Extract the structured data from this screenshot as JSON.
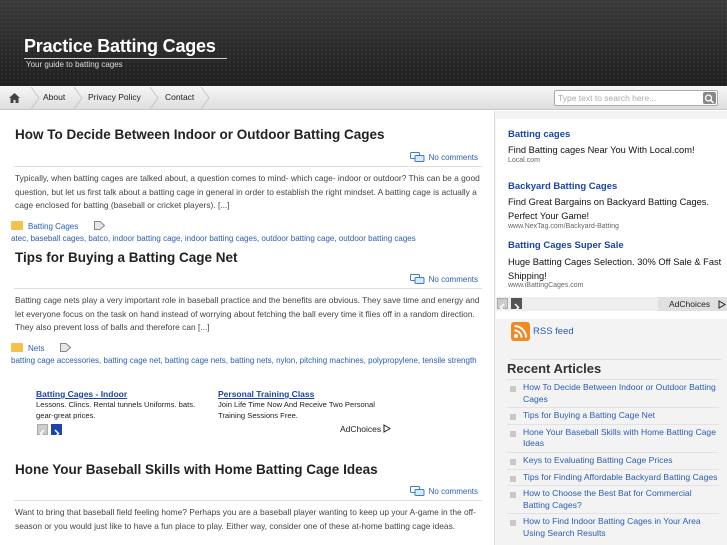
{
  "header": {
    "site_title": "Practice Batting Cages",
    "tagline": "Your guide to batting cages"
  },
  "nav": {
    "home_icon": "home-icon",
    "items": [
      "About",
      "Privacy Policy",
      "Contact"
    ],
    "search_placeholder": "Type text to search here..."
  },
  "posts": [
    {
      "title": "How To Decide Between Indoor or Outdoor Batting Cages",
      "comments": "No comments",
      "excerpt": "Typically, when batting cages are talked about, a question comes to mind- which cage- indoor or outdoor? This can be a good question, but let us first talk about a batting cage in general in order to establish the right mindset. A batting cage is actually a cage enclosed for batting (baseball or cricket players). [...]",
      "category": "Batting Cages",
      "tags": "atec, baseball cages, batco, indoor batting cage, indoor batting cages, outdoor batting cage, outdoor batting cages"
    },
    {
      "title": "Tips for Buying a Batting Cage Net",
      "comments": "No comments",
      "excerpt": "Batting cage nets play a very important role in baseball practice and the benefits are obvious. They save time and energy and let everyone focus on the task on hand instead of worrying about fetching the ball every time it flies off in a random direction. They also prevent loss of balls and therefore can [...]",
      "category": "Nets",
      "tags": "batting cage accessories, batting cage net, batting cage nets, batting nets, nylon, pitching machines, polypropylene, tensile strength"
    },
    {
      "title": "Hone Your Baseball Skills with Home Batting Cage Ideas",
      "comments": "No comments",
      "excerpt": "Want to bring that baseball field feeling home? Perhaps you are a baseball player wanting to keep up your A-game in the off-season or you would just like to have a fun place to play. Either way, consider one of these at-home batting cage ideas."
    }
  ],
  "inline_ad": {
    "ads": [
      {
        "title": "Batting Cages - Indoor",
        "text": "Lessons. Clincs. Rental tunnels Uniforms. bats. gear-great prices."
      },
      {
        "title": "Personal Training Class",
        "text": "Join Life Time Now And Receive Two Personal Training Sessions Free."
      }
    ],
    "adchoices": "AdChoices"
  },
  "sidebar": {
    "ads": [
      {
        "title": "Batting cages",
        "text": "Find Batting cages Near You With Local.com!",
        "url": "Local.com"
      },
      {
        "title": "Backyard Batting Cages",
        "text": "Find Great Bargains on Backyard Batting Cages. Perfect Your Game!",
        "url": "www.NexTag.com/Backyard-Batting"
      },
      {
        "title": "Batting Cages Super Sale",
        "text": "Huge Batting Cages Selection. 30% Off Sale & Fast Shipping!",
        "url": "www.iBattingCages.com"
      }
    ],
    "adchoices": "AdChoices",
    "rss_label": "RSS feed",
    "recent_title": "Recent Articles",
    "recent": [
      "How To Decide Between Indoor or Outdoor Batting Cages",
      "Tips for Buying a Batting Cage Net",
      "Hone Your Baseball Skills with Home Batting Cage Ideas",
      "Keys to Evaluating Batting Cage Prices",
      "Tips for Finding Affordable Backyard Batting Cages",
      "How to Choose the Best Bat for Commercial Batting Cages?",
      "How to Find Indoor Batting Cages in Your Area Using Search Results"
    ]
  }
}
